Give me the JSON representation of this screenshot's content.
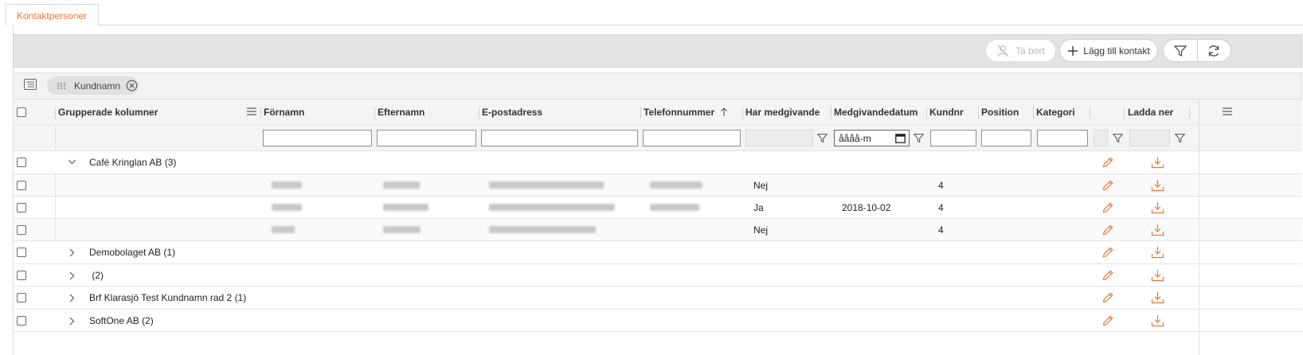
{
  "tab": {
    "label": "Kontaktpersoner"
  },
  "toolbar": {
    "delete_label": "Ta bort",
    "add_label": "Lägg till kontakt"
  },
  "groupbar": {
    "chip_label": "Kundnamn"
  },
  "columns": {
    "grouped": "Grupperade kolumner",
    "firstname": "Förnamn",
    "lastname": "Efternamn",
    "email": "E-postadress",
    "phone": "Telefonnummer",
    "consent": "Har medgivande",
    "consent_date": "Medgivandedatum",
    "customer_no": "Kundnr",
    "position": "Position",
    "category": "Kategori",
    "download": "Ladda ner"
  },
  "filters": {
    "date_placeholder": "åååå-m"
  },
  "groups": {
    "g1": {
      "name": "Café Kringlan AB",
      "count": "(3)"
    },
    "g2": {
      "name": "Demobolaget AB",
      "count": "(1)"
    },
    "g3": {
      "name": "",
      "count": "(2)"
    },
    "g4": {
      "name": "Brf Klarasjö Test Kundnamn rad 2",
      "count": "(1)"
    },
    "g5": {
      "name": "SoftOne AB",
      "count": "(2)"
    }
  },
  "rows": [
    {
      "consent": "Nej",
      "consent_date": "",
      "customer_no": "4"
    },
    {
      "consent": "Ja",
      "consent_date": "2018-10-02",
      "customer_no": "4"
    },
    {
      "consent": "Nej",
      "consent_date": "",
      "customer_no": "4"
    }
  ],
  "colors": {
    "accent": "#e8783e",
    "toolbar_bg": "#e4e4e4",
    "header_bg": "#f4f4f4"
  },
  "icons": {
    "delete": "user-remove-icon",
    "add": "plus-icon",
    "filter": "filter-icon",
    "refresh": "refresh-icon",
    "group_panel": "group-panel-icon",
    "drag": "drag-handle-icon",
    "remove": "close-circle-icon",
    "menu": "column-menu-icon",
    "sort": "sort-ascending-icon",
    "edit": "pencil-icon",
    "download": "download-icon",
    "calendar": "calendar-icon",
    "expand": "chevron-right-icon",
    "collapse": "chevron-down-icon"
  }
}
